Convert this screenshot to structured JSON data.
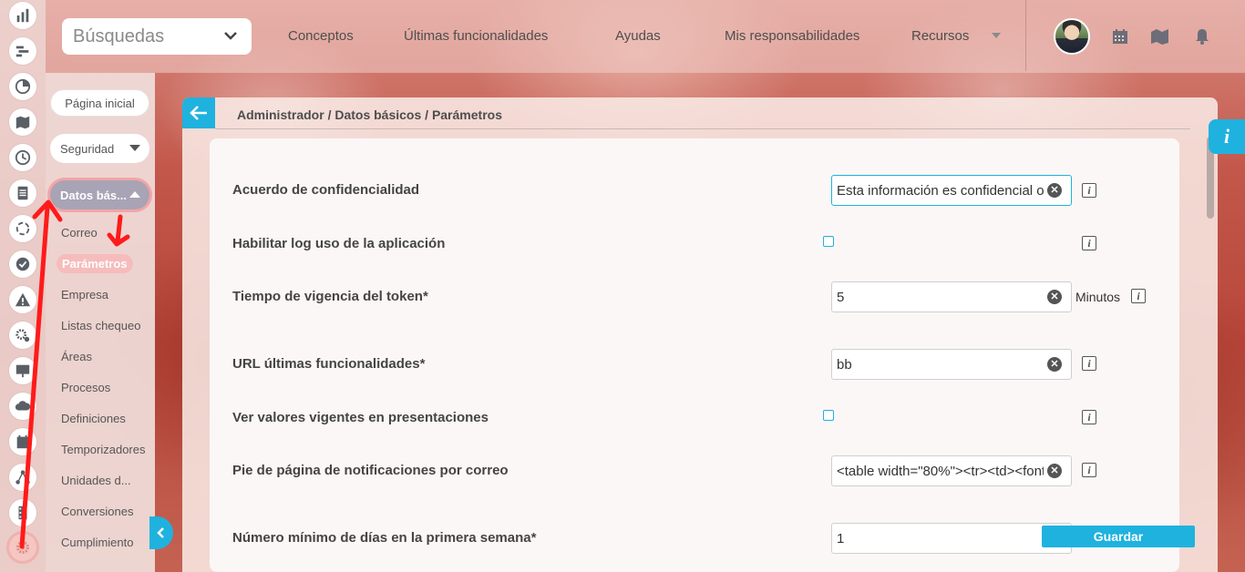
{
  "header": {
    "search_select": "Búsquedas",
    "nav": [
      "Conceptos",
      "Últimas funcionalidades",
      "Ayudas",
      "Mis responsabilidades",
      "Recursos"
    ]
  },
  "rail": {
    "icons": [
      "bar-chart-icon",
      "gantt-icon",
      "pie-chart-icon",
      "book-map-icon",
      "clock-icon",
      "document-icon",
      "cycle-icon",
      "check-circle-icon",
      "warning-icon",
      "gears-icon",
      "presentation-icon",
      "cloud-icon",
      "calendar-icon",
      "network-icon",
      "film-icon",
      "settings-icon"
    ],
    "active": "settings-icon"
  },
  "sidebar": {
    "home": "Página inicial",
    "security": "Seguridad",
    "basic_data": "Datos bás...",
    "items": [
      "Correo",
      "Parámetros",
      "Empresa",
      "Listas chequeo",
      "Áreas",
      "Procesos",
      "Definiciones",
      "Temporizadores",
      "Unidades d...",
      "Conversiones",
      "Cumplimiento"
    ],
    "active_item": "Parámetros"
  },
  "panel": {
    "breadcrumb": "Administrador / Datos básicos / Parámetros",
    "rows": [
      {
        "label": "Acuerdo de confidencialidad",
        "type": "text",
        "value": "Esta información es confidencial o"
      },
      {
        "label": "Habilitar log uso de la aplicación",
        "type": "checkbox",
        "checked": false
      },
      {
        "label": "Tiempo de vigencia del token*",
        "type": "text",
        "value": "5",
        "unit": "Minutos"
      },
      {
        "label": "URL últimas funcionalidades*",
        "type": "text",
        "value": "bb"
      },
      {
        "label": "Ver valores vigentes en presentaciones",
        "type": "checkbox",
        "checked": false
      },
      {
        "label": "Pie de página de notificaciones por correo",
        "type": "text",
        "value": "<table width=\"80%\"><tr><td><font"
      },
      {
        "label": "Número mínimo de días en la primera semana*",
        "type": "text",
        "value": "1"
      }
    ],
    "save_label": "Guardar",
    "info_tab": "i"
  },
  "colors": {
    "accent": "#1fb2df",
    "annotation": "#ff1a1a"
  }
}
